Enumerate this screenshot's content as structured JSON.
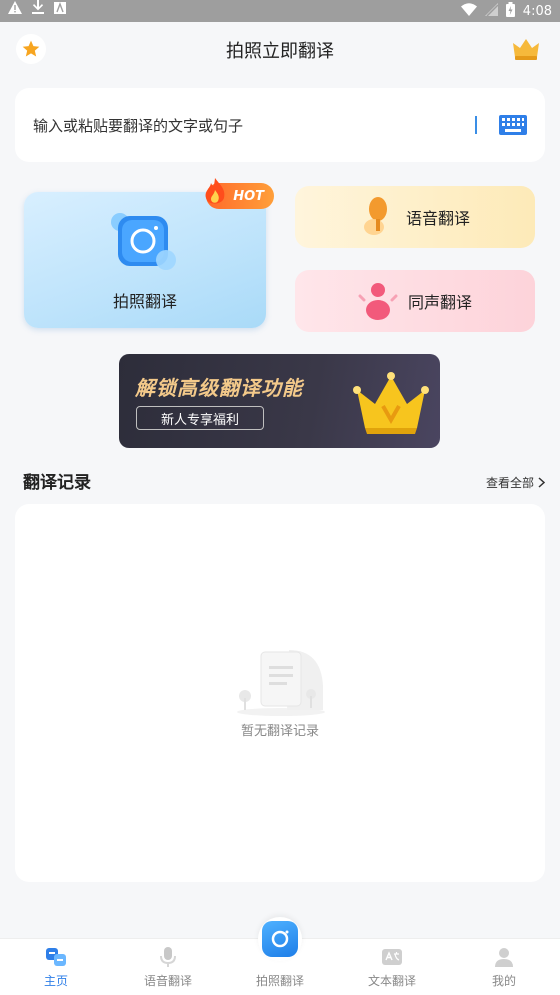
{
  "status_bar": {
    "time": "4:08",
    "left_icons": [
      "warning-icon",
      "download-icon",
      "text-icon"
    ],
    "right_icons": [
      "wifi-icon",
      "signal-icon",
      "battery-icon"
    ]
  },
  "header": {
    "title": "拍照立即翻译",
    "vip_text": "VIP"
  },
  "input": {
    "placeholder": "输入或粘贴要翻译的文字或句子"
  },
  "features": {
    "photo_label": "拍照翻译",
    "hot_badge": "HOT",
    "voice_label": "语音翻译",
    "sync_label": "同声翻译"
  },
  "banner": {
    "title": "解锁高级翻译功能",
    "button_label": "新人专享福利"
  },
  "history": {
    "title": "翻译记录",
    "view_all": "查看全部",
    "empty_text": "暂无翻译记录"
  },
  "bottom_nav": {
    "items": [
      {
        "label": "主页",
        "icon": "home-icon",
        "active": true
      },
      {
        "label": "语音翻译",
        "icon": "microphone-icon",
        "active": false
      },
      {
        "label": "拍照翻译",
        "icon": "camera-icon",
        "active": false
      },
      {
        "label": "文本翻译",
        "icon": "text-translate-icon",
        "active": false
      },
      {
        "label": "我的",
        "icon": "profile-icon",
        "active": false
      }
    ]
  },
  "colors": {
    "accent": "#2f7fe8",
    "hot": "#ff6a2b",
    "banner_bg": "#2d2d3a",
    "banner_gold": "#f3c98a"
  }
}
